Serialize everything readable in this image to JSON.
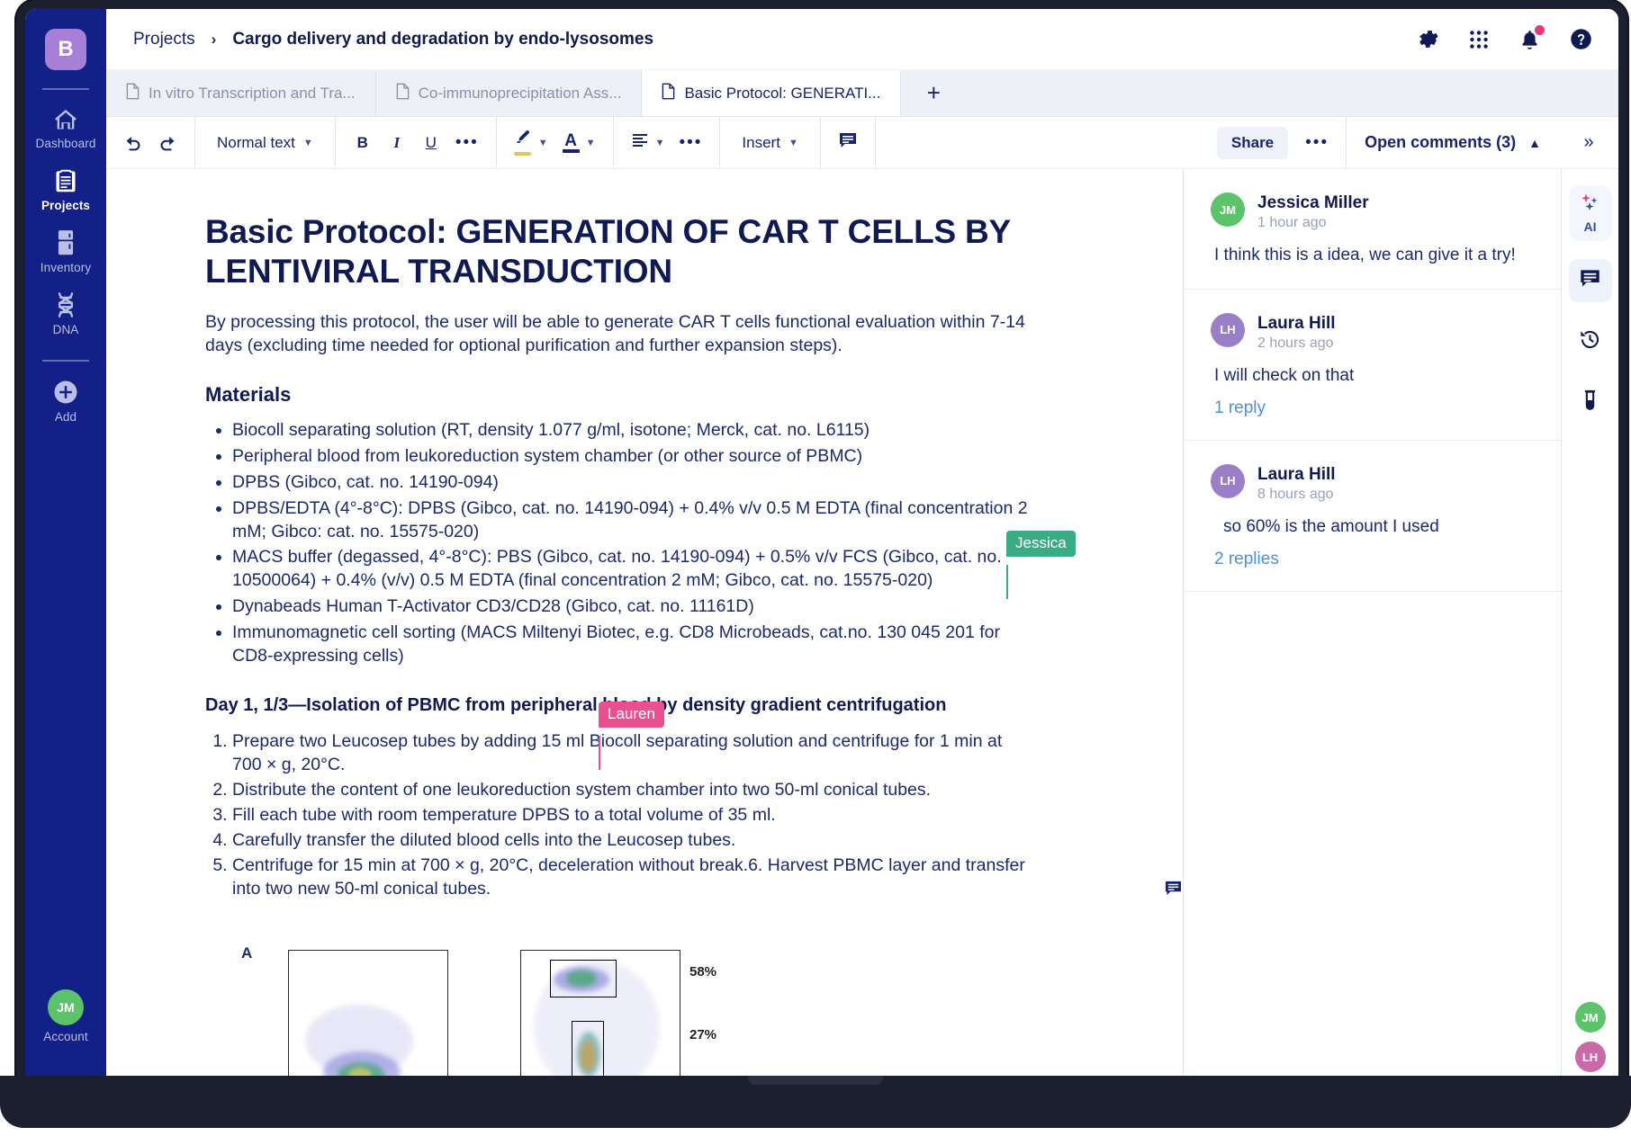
{
  "app": {
    "logo_letter": "B"
  },
  "sidebar": {
    "items": [
      {
        "label": "Dashboard",
        "icon": "home-icon"
      },
      {
        "label": "Projects",
        "icon": "clipboard-icon"
      },
      {
        "label": "Inventory",
        "icon": "fridge-icon"
      },
      {
        "label": "DNA",
        "icon": "dna-helix-icon"
      },
      {
        "label": "Add",
        "icon": "plus-circle-icon"
      }
    ],
    "account": {
      "initials": "JM",
      "label": "Account",
      "color": "#5cc36a"
    }
  },
  "header": {
    "breadcrumb_root": "Projects",
    "breadcrumb_sep": "›",
    "breadcrumb_current": "Cargo delivery and degradation by endo-lysosomes",
    "icons": [
      "gear-icon",
      "apps-grid-icon",
      "bell-icon",
      "help-icon"
    ]
  },
  "tabs": {
    "items": [
      {
        "label": "In vitro Transcription and Tra...",
        "active": false
      },
      {
        "label": "Co-immunoprecipitation Ass...",
        "active": false
      },
      {
        "label": "Basic Protocol: GENERATI...",
        "active": true
      }
    ],
    "add_label": "+"
  },
  "toolbar": {
    "undo": "↺",
    "redo": "↻",
    "style_label": "Normal text",
    "bold": "B",
    "italic": "I",
    "underline": "U",
    "more": "•••",
    "align_more": "•••",
    "insert_label": "Insert",
    "share_label": "Share",
    "share_more": "•••",
    "open_comments_label": "Open comments (3)",
    "collapse": "»"
  },
  "document": {
    "title": "Basic Protocol: GENERATION OF CAR T CELLS BY LENTIVIRAL TRANSDUCTION",
    "intro": "By processing this protocol, the user will be able to generate CAR T cells functional evaluation within 7-14 days (excluding time needed for optional purification and further expansion steps).",
    "materials_heading": "Materials",
    "materials": [
      "Biocoll separating solution (RT, density 1.077 g/ml, isotone; Merck, cat. no. L6115)",
      "Peripheral blood from leukoreduction system chamber (or other source of PBMC)",
      "DPBS (Gibco, cat. no. 14190-094)",
      "DPBS/EDTA (4°-8°C): DPBS (Gibco, cat. no. 14190-094) + 0.4% v/v 0.5 M EDTA (final concentration 2 mM; Gibco: cat. no. 15575-020)",
      "MACS buffer (degassed, 4°-8°C): PBS (Gibco, cat. no. 14190-094) + 0.5% v/v FCS (Gibco, cat. no. 10500064) + 0.4% (v/v) 0.5 M EDTA (final concentration 2 mM; Gibco, cat. no. 15575-020)",
      "Dynabeads Human T-Activator CD3/CD28 (Gibco, cat. no. 11161D)",
      "Immunomagnetic cell sorting (MACS Miltenyi Biotec, e.g. CD8 Microbeads, cat.no. 130 045 201 for CD8-expressing cells)"
    ],
    "day_heading": "Day 1, 1/3—Isolation of PBMC from peripheral blood by density gradient centrifugation",
    "steps": [
      "Prepare two Leucosep tubes by adding 15 ml Biocoll separating solution and centrifuge for 1 min at 700 × g, 20°C.",
      "Distribute the content of one leukoreduction system chamber into two 50-ml conical tubes.",
      "Fill each tube with room temperature DPBS to a total volume of 35 ml.",
      "Carefully transfer the diluted blood cells into the Leucosep tubes.",
      "Centrifuge for 15 min at 700 × g, 20°C, deceleration without break.6. Harvest PBMC layer and transfer into two new 50-ml conical tubes."
    ],
    "inline_comment_count": "1",
    "figure": {
      "panel_label": "A",
      "gate_labels": [
        "58%",
        "27%"
      ]
    }
  },
  "cursors": [
    {
      "name": "Jessica",
      "color": "#3aab83"
    },
    {
      "name": "Lauren",
      "color": "#e8508f"
    }
  ],
  "comments": {
    "items": [
      {
        "author": "Jessica Miller",
        "initials": "JM",
        "color": "#5cc36a",
        "time": "1 hour ago",
        "text": "I think this is a idea, we can give it a try!",
        "replies": ""
      },
      {
        "author": "Laura Hill",
        "initials": "LH",
        "color": "#9b7ec8",
        "time": "2 hours ago",
        "text": "I will check on that",
        "replies": "1 reply"
      },
      {
        "author": "Laura Hill",
        "initials": "LH",
        "color": "#9b7ec8",
        "time": "8 hours ago",
        "text": "so 60% is the amount I used",
        "replies": "2 replies"
      }
    ]
  },
  "rail": {
    "ai_label": "AI",
    "icons": [
      "ai-sparkle-icon",
      "comment-icon",
      "history-clock-icon",
      "test-tube-icon"
    ],
    "presence": [
      {
        "initials": "JM",
        "color": "#5cc36a"
      },
      {
        "initials": "LH",
        "color": "#c86aa8"
      }
    ]
  },
  "colors": {
    "nav_bg": "#132088",
    "accent": "#17246b",
    "highlight_yellow": "#e8c455",
    "link_blue": "#4f8fd8"
  }
}
